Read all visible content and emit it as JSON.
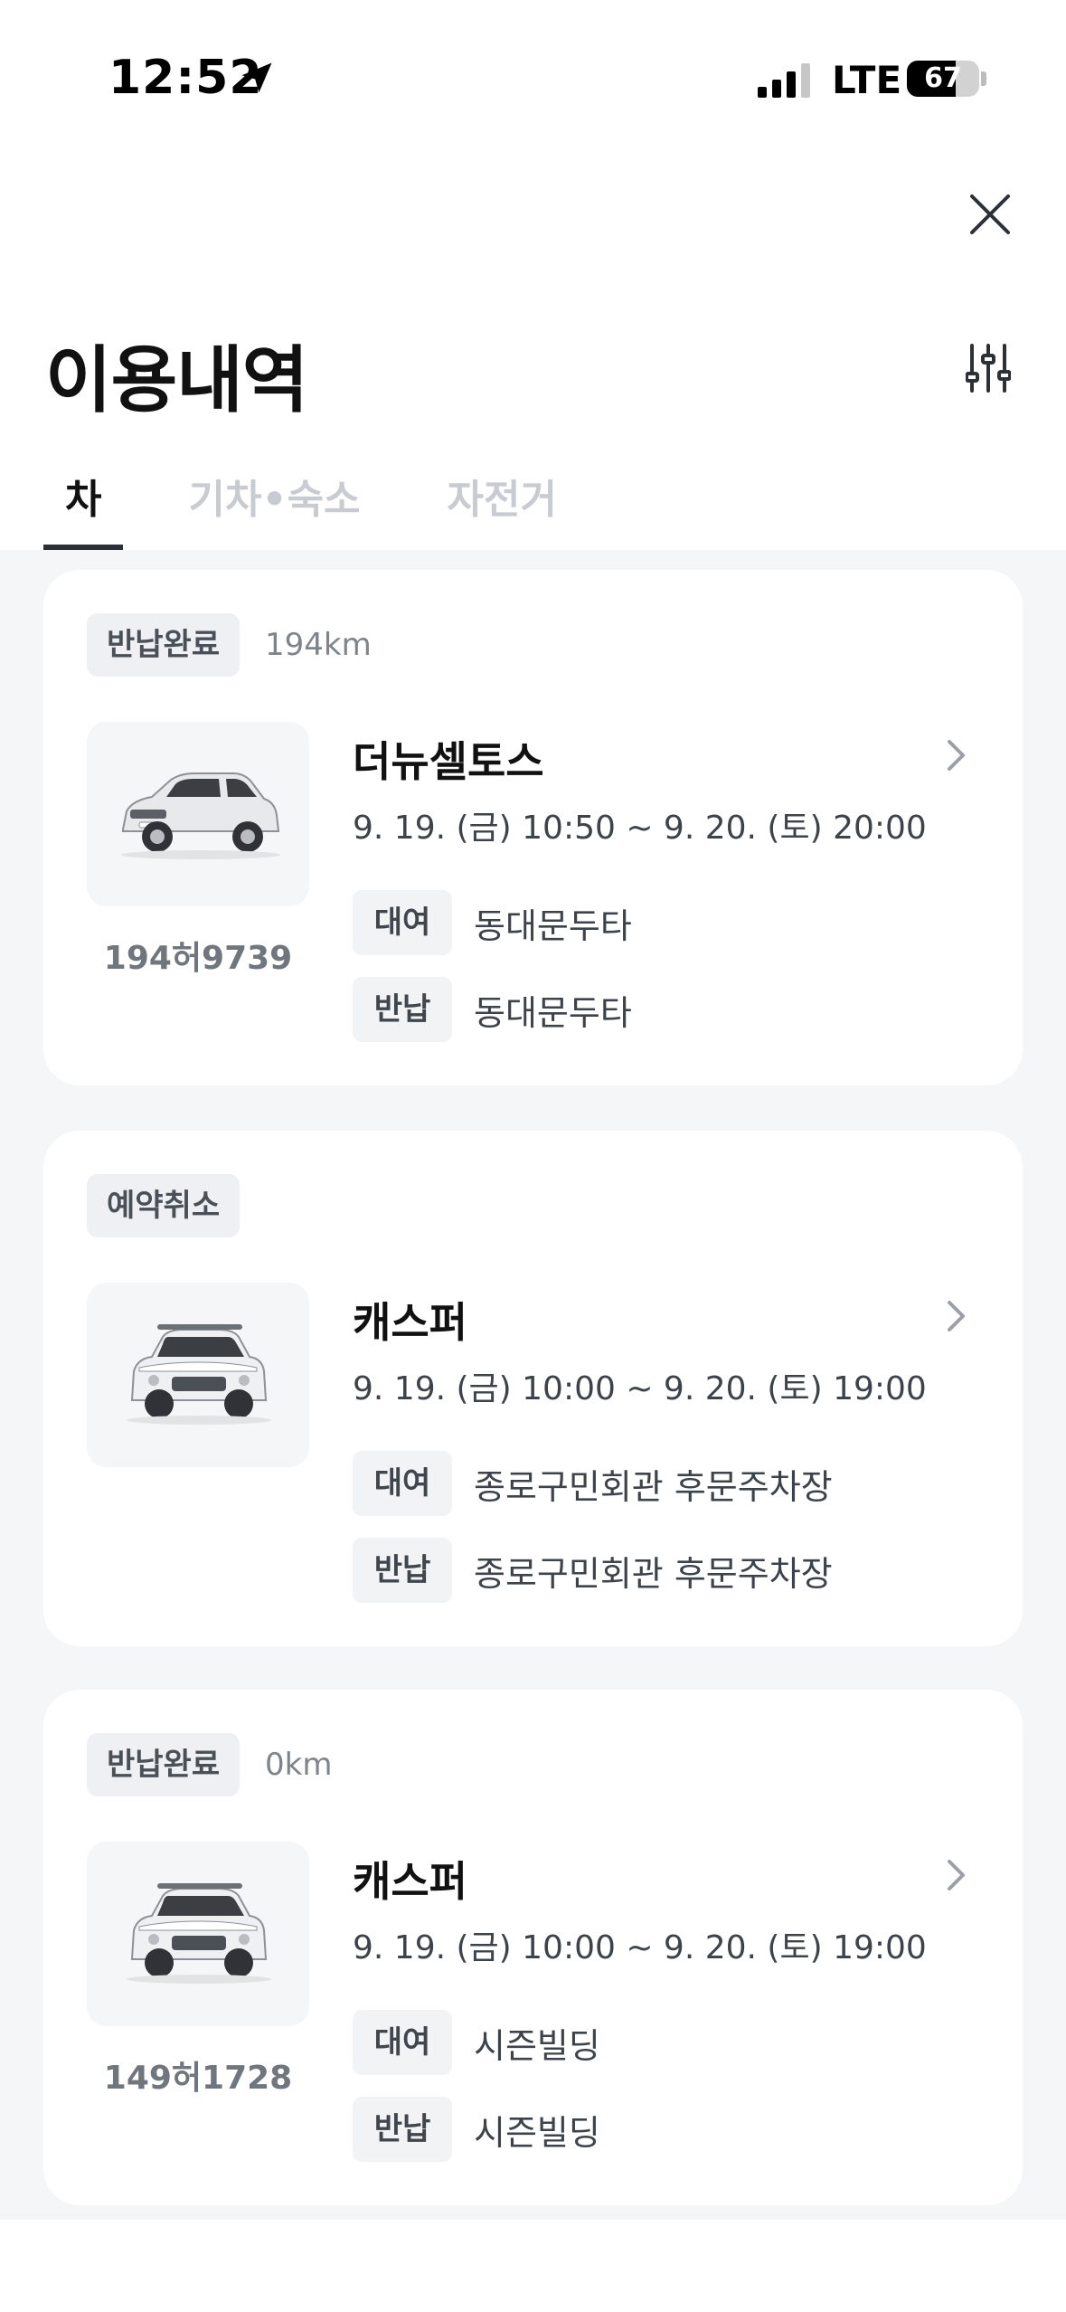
{
  "status_bar": {
    "time": "12:52",
    "network": "LTE",
    "battery_level": 67,
    "battery_text": "67",
    "location_icon": "location-arrow-icon",
    "signal_icon": "cellular-signal-icon"
  },
  "header": {
    "title": "이용내역",
    "close_icon": "close-icon",
    "filter_icon": "filter-sliders-icon"
  },
  "tabs": [
    {
      "label": "차",
      "active": true
    },
    {
      "label": "기차•숙소",
      "active": false
    },
    {
      "label": "자전거",
      "active": false
    }
  ],
  "labels": {
    "rent": "대여",
    "return": "반납"
  },
  "cards": [
    {
      "status": "반납완료",
      "distance": "194km",
      "car_name": "더뉴셀토스",
      "plate": "194허9739",
      "period": "9. 19. (금) 10:50 ~ 9. 20. (토) 20:00",
      "rent_location": "동대문두타",
      "return_location": "동대문두타"
    },
    {
      "status": "예약취소",
      "distance": "",
      "car_name": "캐스퍼",
      "plate": "",
      "period": "9. 19. (금) 10:00 ~ 9. 20. (토) 19:00",
      "rent_location": "종로구민회관 후문주차장",
      "return_location": "종로구민회관 후문주차장"
    },
    {
      "status": "반납완료",
      "distance": "0km",
      "car_name": "캐스퍼",
      "plate": "149허1728",
      "period": "9. 19. (금) 10:00 ~ 9. 20. (토) 19:00",
      "rent_location": "시즌빌딩",
      "return_location": "시즌빌딩"
    }
  ],
  "colors": {
    "background": "#f5f6f8",
    "card": "#ffffff",
    "accent_dark": "#2b3137",
    "muted_tab": "#c8ccd2"
  }
}
